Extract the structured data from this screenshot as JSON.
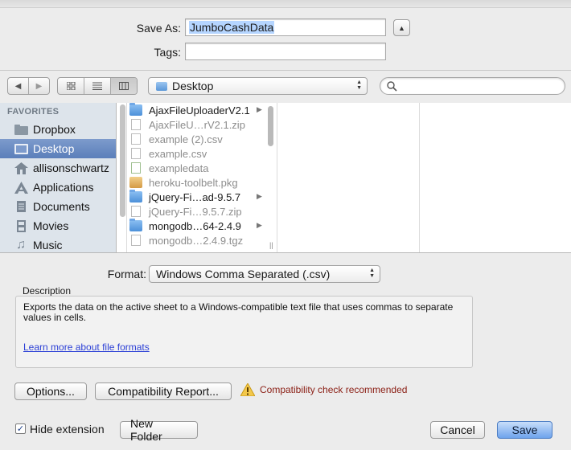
{
  "save_panel": {
    "save_as_label": "Save As:",
    "save_as_value": "JumboCashData",
    "tags_label": "Tags:",
    "tags_value": "",
    "collapse_icon": "triangle-up-icon"
  },
  "toolbar": {
    "location": "Desktop",
    "search_placeholder": ""
  },
  "sidebar": {
    "heading": "FAVORITES",
    "items": [
      {
        "label": "Dropbox",
        "icon": "folder-icon"
      },
      {
        "label": "Desktop",
        "icon": "desktop-icon"
      },
      {
        "label": "allisonschwartz",
        "icon": "home-icon"
      },
      {
        "label": "Applications",
        "icon": "applications-icon"
      },
      {
        "label": "Documents",
        "icon": "documents-icon"
      },
      {
        "label": "Movies",
        "icon": "movies-icon"
      },
      {
        "label": "Music",
        "icon": "music-icon"
      }
    ]
  },
  "files": [
    {
      "name": "AjaxFileUploaderV2.1",
      "type": "folder"
    },
    {
      "name": "AjaxFileU…rV2.1.zip",
      "type": "doc"
    },
    {
      "name": "example (2).csv",
      "type": "doc"
    },
    {
      "name": "example.csv",
      "type": "doc"
    },
    {
      "name": "exampledata",
      "type": "xls"
    },
    {
      "name": "heroku-toolbelt.pkg",
      "type": "pkg"
    },
    {
      "name": "jQuery-Fi…ad-9.5.7",
      "type": "folder"
    },
    {
      "name": "jQuery-Fi…9.5.7.zip",
      "type": "doc"
    },
    {
      "name": "mongodb…64-2.4.9",
      "type": "folder"
    },
    {
      "name": "mongodb…2.4.9.tgz",
      "type": "doc"
    }
  ],
  "format": {
    "label": "Format:",
    "value": "Windows Comma Separated (.csv)"
  },
  "description": {
    "heading": "Description",
    "text": "Exports the data on the active sheet to a Windows-compatible text file that uses commas to separate values in cells.",
    "link": "Learn more about file formats"
  },
  "buttons": {
    "options": "Options...",
    "compat_report": "Compatibility Report...",
    "new_folder": "New Folder",
    "cancel": "Cancel",
    "save": "Save"
  },
  "warning": {
    "text": "Compatibility check recommended",
    "icon": "warning-icon"
  },
  "hide_extension": {
    "label": "Hide extension",
    "checked": true
  }
}
